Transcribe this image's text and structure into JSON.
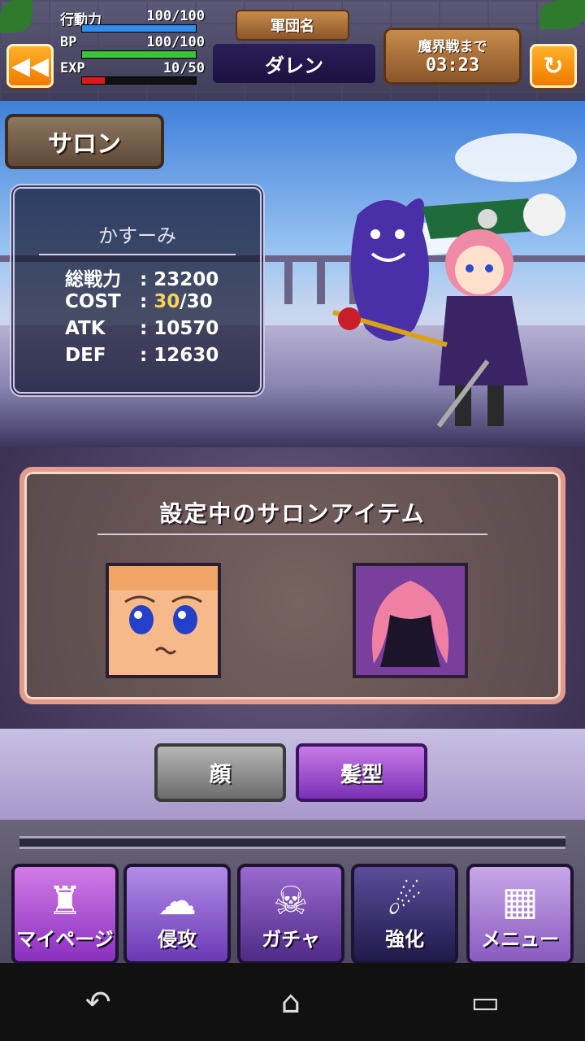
{
  "hud": {
    "back_label": "◀◀",
    "stamina_label": "行動力",
    "stamina_value": "100/100",
    "stamina_ratio": 1.0,
    "bp_label": "BP",
    "bp_value": "100/100",
    "bp_ratio": 1.0,
    "exp_label": "EXP",
    "exp_value": "10/50",
    "exp_ratio": 0.2,
    "corps_label": "軍団名",
    "corps_name": "ダレン",
    "timer_label": "魔界戦まで",
    "timer_value": "03:23",
    "reload_label": "↻",
    "colors": {
      "stamina": "#2f8ff0",
      "bp": "#3cc43a",
      "exp": "#e01818"
    }
  },
  "scene": {
    "sign": "サロン",
    "char_name": "かすーみ",
    "stats": [
      {
        "key": "総戦力",
        "value": "23200"
      },
      {
        "key": "COST",
        "value_hl": "30",
        "value_rest": "/30"
      },
      {
        "key": "ATK",
        "value": "10570"
      },
      {
        "key": "DEF",
        "value": "12630"
      }
    ]
  },
  "salon": {
    "title": "設定中のサロンアイテム"
  },
  "tabs": {
    "face": "顔",
    "hair": "髪型"
  },
  "nav": {
    "items": [
      {
        "label": "マイページ",
        "icon": "castle-icon"
      },
      {
        "label": "侵攻",
        "icon": "map-icon"
      },
      {
        "label": "ガチャ",
        "icon": "skull-icon"
      },
      {
        "label": "強化",
        "icon": "power-icon"
      },
      {
        "label": "メニュー",
        "icon": "grid-icon"
      }
    ]
  },
  "system": {
    "back": "↶",
    "home": "⌂",
    "recents": "▭"
  }
}
